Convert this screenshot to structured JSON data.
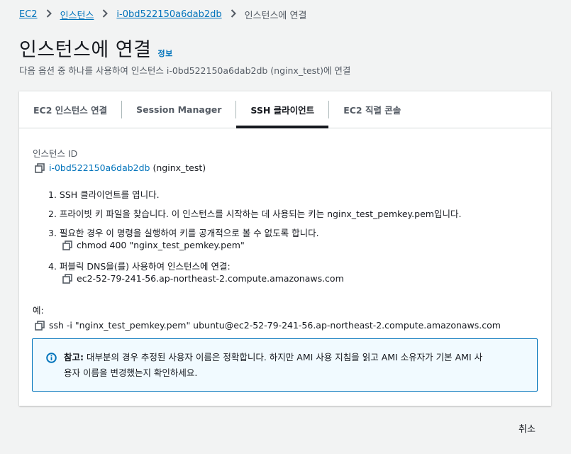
{
  "breadcrumb": {
    "items": [
      "EC2",
      "인스턴스",
      "i-0bd522150a6dab2db"
    ],
    "current": "인스턴스에 연결"
  },
  "header": {
    "title": "인스턴스에 연결",
    "info": "정보",
    "subtitle": "다음 옵션 중 하나를 사용하여 인스턴스 i-0bd522150a6dab2db (nginx_test)에 연결"
  },
  "tabs": [
    {
      "label": "EC2 인스턴스 연결"
    },
    {
      "label": "Session Manager"
    },
    {
      "label": "SSH 클라이언트"
    },
    {
      "label": "EC2 직렬 콘솔"
    }
  ],
  "ssh": {
    "instance_id_label": "인스턴스 ID",
    "instance_id": "i-0bd522150a6dab2db",
    "instance_name": "(nginx_test)",
    "steps": [
      "1. SSH 클라이언트를 엽니다.",
      "2. 프라이빗 키 파일을 찾습니다. 이 인스턴스를 시작하는 데 사용되는 키는 nginx_test_pemkey.pem입니다.",
      "3. 필요한 경우 이 명령을 실행하여 키를 공개적으로 볼 수 없도록 합니다.",
      "4. 퍼블릭 DNS을(를) 사용하여 인스턴스에 연결:"
    ],
    "chmod_cmd": "chmod 400 \"nginx_test_pemkey.pem\"",
    "dns": "ec2-52-79-241-56.ap-northeast-2.compute.amazonaws.com",
    "example_label": "예:",
    "example_cmd": "ssh -i \"nginx_test_pemkey.pem\" ubuntu@ec2-52-79-241-56.ap-northeast-2.compute.amazonaws.com"
  },
  "alert": {
    "title": "참고:",
    "line1": "대부분의 경우 추정된 사용자 이름은 정확합니다. 하지만 AMI 사용 지침을 읽고 AMI 소유자가 기본 AMI 사",
    "line2": "용자 이름을 변경했는지 확인하세요."
  },
  "footer": {
    "cancel": "취소"
  },
  "colors": {
    "link": "#0073bb",
    "alert_bg": "#f1faff",
    "alert_border": "#0073bb",
    "text": "#16191f",
    "muted": "#545b64"
  },
  "icons": [
    "chevron-right-icon",
    "copy-icon",
    "info-circle-icon"
  ]
}
